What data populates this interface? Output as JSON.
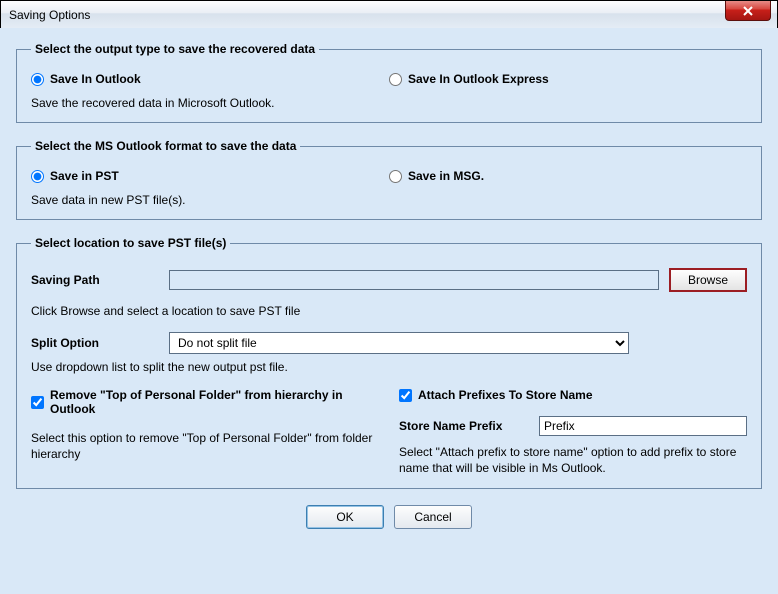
{
  "window": {
    "title": "Saving Options"
  },
  "group_output": {
    "legend": "Select the output type to save the recovered data",
    "opt_outlook": "Save In Outlook",
    "opt_outlook_express": "Save In Outlook Express",
    "desc": "Save the recovered data in Microsoft Outlook."
  },
  "group_format": {
    "legend": "Select the MS Outlook format to save the data",
    "opt_pst": "Save in PST",
    "opt_msg": "Save in MSG.",
    "desc": "Save data in new PST file(s)."
  },
  "group_location": {
    "legend": "Select location to save PST file(s)",
    "saving_path_label": "Saving Path",
    "saving_path_value": "",
    "browse_label": "Browse",
    "browse_hint": "Click Browse and select a location to save PST file",
    "split_label": "Split Option",
    "split_selected": "Do not split file",
    "split_hint": "Use dropdown list to split the new output pst file.",
    "remove_top_label": "Remove \"Top of Personal Folder\" from hierarchy in Outlook",
    "remove_top_desc": "Select this option to remove \"Top of Personal Folder\" from folder hierarchy",
    "attach_prefixes_label": "Attach Prefixes To Store Name",
    "store_prefix_label": "Store Name Prefix",
    "store_prefix_value": "Prefix",
    "attach_prefix_desc": "Select \"Attach prefix to store name\" option to add prefix to store name that will be visible in Ms Outlook."
  },
  "buttons": {
    "ok": "OK",
    "cancel": "Cancel"
  }
}
